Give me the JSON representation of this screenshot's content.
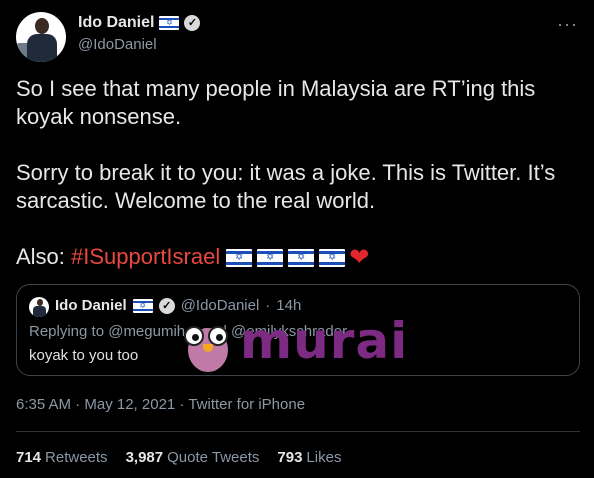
{
  "author": {
    "name": "Ido Daniel",
    "handle": "@IdoDaniel",
    "flag_icon": "israel-flag",
    "verified_icon": "verified-badge-icon"
  },
  "more_icon": "more-options-icon",
  "tweet": {
    "paragraph1": "So I see that many people in Malaysia are RT’ing this koyak nonsense.",
    "paragraph2": "Sorry to break it to you: it was a joke. This is Twitter. It’s sarcastic. Welcome to the real world.",
    "also_prefix": "Also: ",
    "hashtag": "#ISupportIsrael",
    "flag_count": 4,
    "heart": "❤"
  },
  "quoted_tweet": {
    "name": "Ido Daniel",
    "handle": "@IdoDaniel",
    "separator": "·",
    "time": "14h",
    "replying_to": "Replying to @megumih... and @emilykschrader",
    "text": "koyak to you too"
  },
  "watermark": {
    "text": "murai"
  },
  "meta": {
    "timestamp": "6:35 AM · May 12, 2021 · Twitter for iPhone"
  },
  "stats": {
    "retweets_count": "714",
    "retweets_label": "Retweets",
    "quotes_count": "3,987",
    "quotes_label": "Quote Tweets",
    "likes_count": "793",
    "likes_label": "Likes"
  },
  "colors": {
    "background": "#000000",
    "hashtag": "#e9483f",
    "heart": "#e0272d",
    "watermark": "#7d2b82",
    "secondary_text": "#8b98a5"
  }
}
